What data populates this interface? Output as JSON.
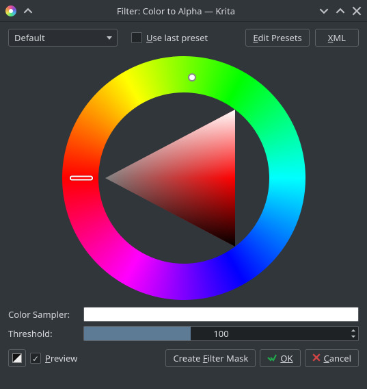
{
  "window": {
    "title": "Filter: Color to Alpha — Krita"
  },
  "toolbar": {
    "preset_value": "Default",
    "use_last_preset": "Use last preset",
    "use_last_preset_checked": false,
    "edit_presets": "Edit Presets",
    "xml": "XML"
  },
  "color_picker": {
    "hue_deg": 0,
    "selected_color": "#ffffff"
  },
  "fields": {
    "color_sampler_label": "Color Sampler:",
    "color_sampler_value": "#ffffff",
    "threshold_label": "Threshold:",
    "threshold_value": "100",
    "threshold_min": 0,
    "threshold_max": 255,
    "threshold_fill_pct": 39
  },
  "buttons": {
    "preview_label": "Preview",
    "preview_checked": true,
    "create_mask": "Create Filter Mask",
    "ok": "OK",
    "cancel": "Cancel"
  }
}
